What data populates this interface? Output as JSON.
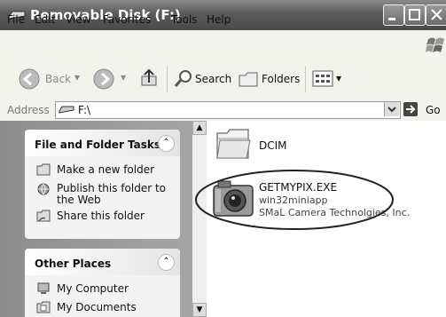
{
  "window": {
    "title": "Removable Disk (F:)"
  },
  "menubar": {
    "items": [
      "File",
      "Edit",
      "View",
      "Favorites",
      "Tools",
      "Help"
    ]
  },
  "toolbar": {
    "back_label": "Back",
    "search_label": "Search",
    "folders_label": "Folders"
  },
  "addressbar": {
    "label": "Address",
    "value": "F:\\",
    "go_label": "Go"
  },
  "tasks_panel": {
    "title": "File and Folder Tasks",
    "items": [
      {
        "label": "Make a new folder",
        "icon": "new-folder-icon"
      },
      {
        "label": "Publish this folder to\nthe Web",
        "icon": "globe-icon"
      },
      {
        "label": "Share this folder",
        "icon": "share-folder-icon"
      }
    ]
  },
  "places_panel": {
    "title": "Other Places",
    "items": [
      {
        "label": "My Computer",
        "icon": "computer-icon"
      },
      {
        "label": "My Documents",
        "icon": "documents-icon"
      }
    ]
  },
  "files": [
    {
      "name": "DCIM",
      "icon": "folder-icon"
    },
    {
      "name": "GETMYPIX.EXE",
      "type": "win32miniapp",
      "company": "SMaL Camera Technolgies, Inc.",
      "icon": "camera-icon"
    }
  ],
  "colors": {
    "titlebar": "#5a5a5a",
    "sidebar": "#999999",
    "chrome": "#f3f3ee"
  }
}
